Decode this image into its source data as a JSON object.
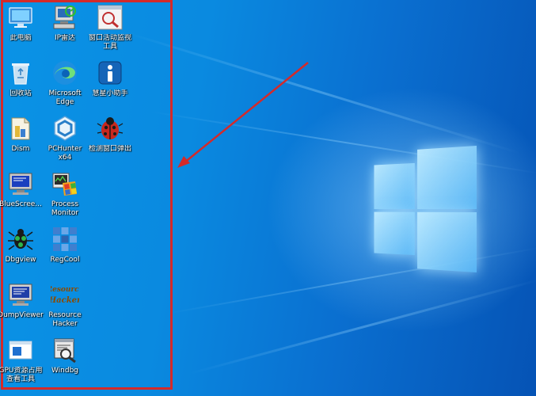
{
  "desktop": {
    "icons": [
      {
        "label": "此电脑",
        "icon": "computer-icon"
      },
      {
        "label": "IP雷达",
        "icon": "ip-radar-icon"
      },
      {
        "label": "窗口活动监视\n工具",
        "icon": "window-monitor-icon"
      },
      {
        "label": "回收站",
        "icon": "recycle-bin-icon"
      },
      {
        "label": "Microsoft\nEdge",
        "icon": "edge-icon"
      },
      {
        "label": "慧星小助手",
        "icon": "assistant-icon"
      },
      {
        "label": "Dism",
        "icon": "dism-icon"
      },
      {
        "label": "PCHunter\nx64",
        "icon": "pchunter-icon"
      },
      {
        "label": "检测窗口弹出",
        "icon": "ladybug-icon"
      },
      {
        "label": "BlueScree...",
        "icon": "bluescreen-icon"
      },
      {
        "label": "Process\nMonitor",
        "icon": "process-monitor-icon"
      },
      {
        "label": "Dbgview",
        "icon": "dbgview-icon"
      },
      {
        "label": "RegCool",
        "icon": "regcool-icon"
      },
      {
        "label": "DumpViewer",
        "icon": "dumpviewer-icon"
      },
      {
        "label": "Resource\nHacker",
        "icon": "resource-hacker-icon"
      },
      {
        "label": "GPU资源占用\n查看工具",
        "icon": "gpu-tool-icon"
      },
      {
        "label": "Windbg",
        "icon": "windbg-icon"
      }
    ],
    "resource_hacker_logo_text": "Resource Hacker"
  },
  "colors": {
    "selection": "#d42a2a",
    "arrow": "#d42a2a",
    "background": "#0a8ae0"
  }
}
